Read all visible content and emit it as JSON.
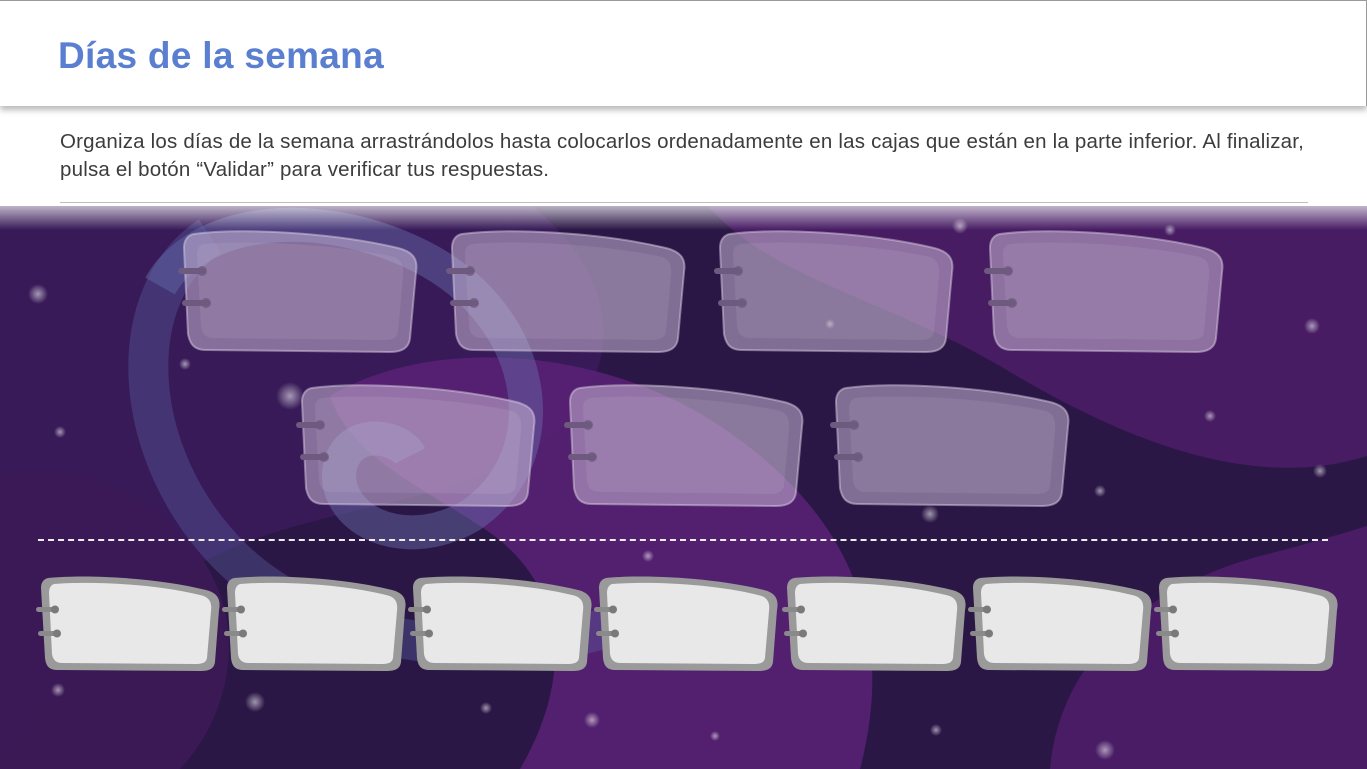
{
  "header": {
    "title": "Días de la semana"
  },
  "instructions": {
    "text": "Organiza los días de la semana arrastrándolos hasta colocarlos ordenadamente en las cajas que están en la parte inferior. Al finalizar, pulsa el botón “Validar” para verificar tus respuestas."
  },
  "activity": {
    "target_slots": [
      {
        "label": ""
      },
      {
        "label": ""
      },
      {
        "label": ""
      },
      {
        "label": ""
      },
      {
        "label": ""
      },
      {
        "label": ""
      },
      {
        "label": ""
      }
    ],
    "day_cards": [
      {
        "label": ""
      },
      {
        "label": ""
      },
      {
        "label": ""
      },
      {
        "label": ""
      },
      {
        "label": ""
      },
      {
        "label": ""
      },
      {
        "label": ""
      }
    ]
  },
  "colors": {
    "title": "#5a7ed0",
    "background": "#2a1744",
    "target_box": "#b89fc0",
    "day_card": "#e8e8e8"
  }
}
